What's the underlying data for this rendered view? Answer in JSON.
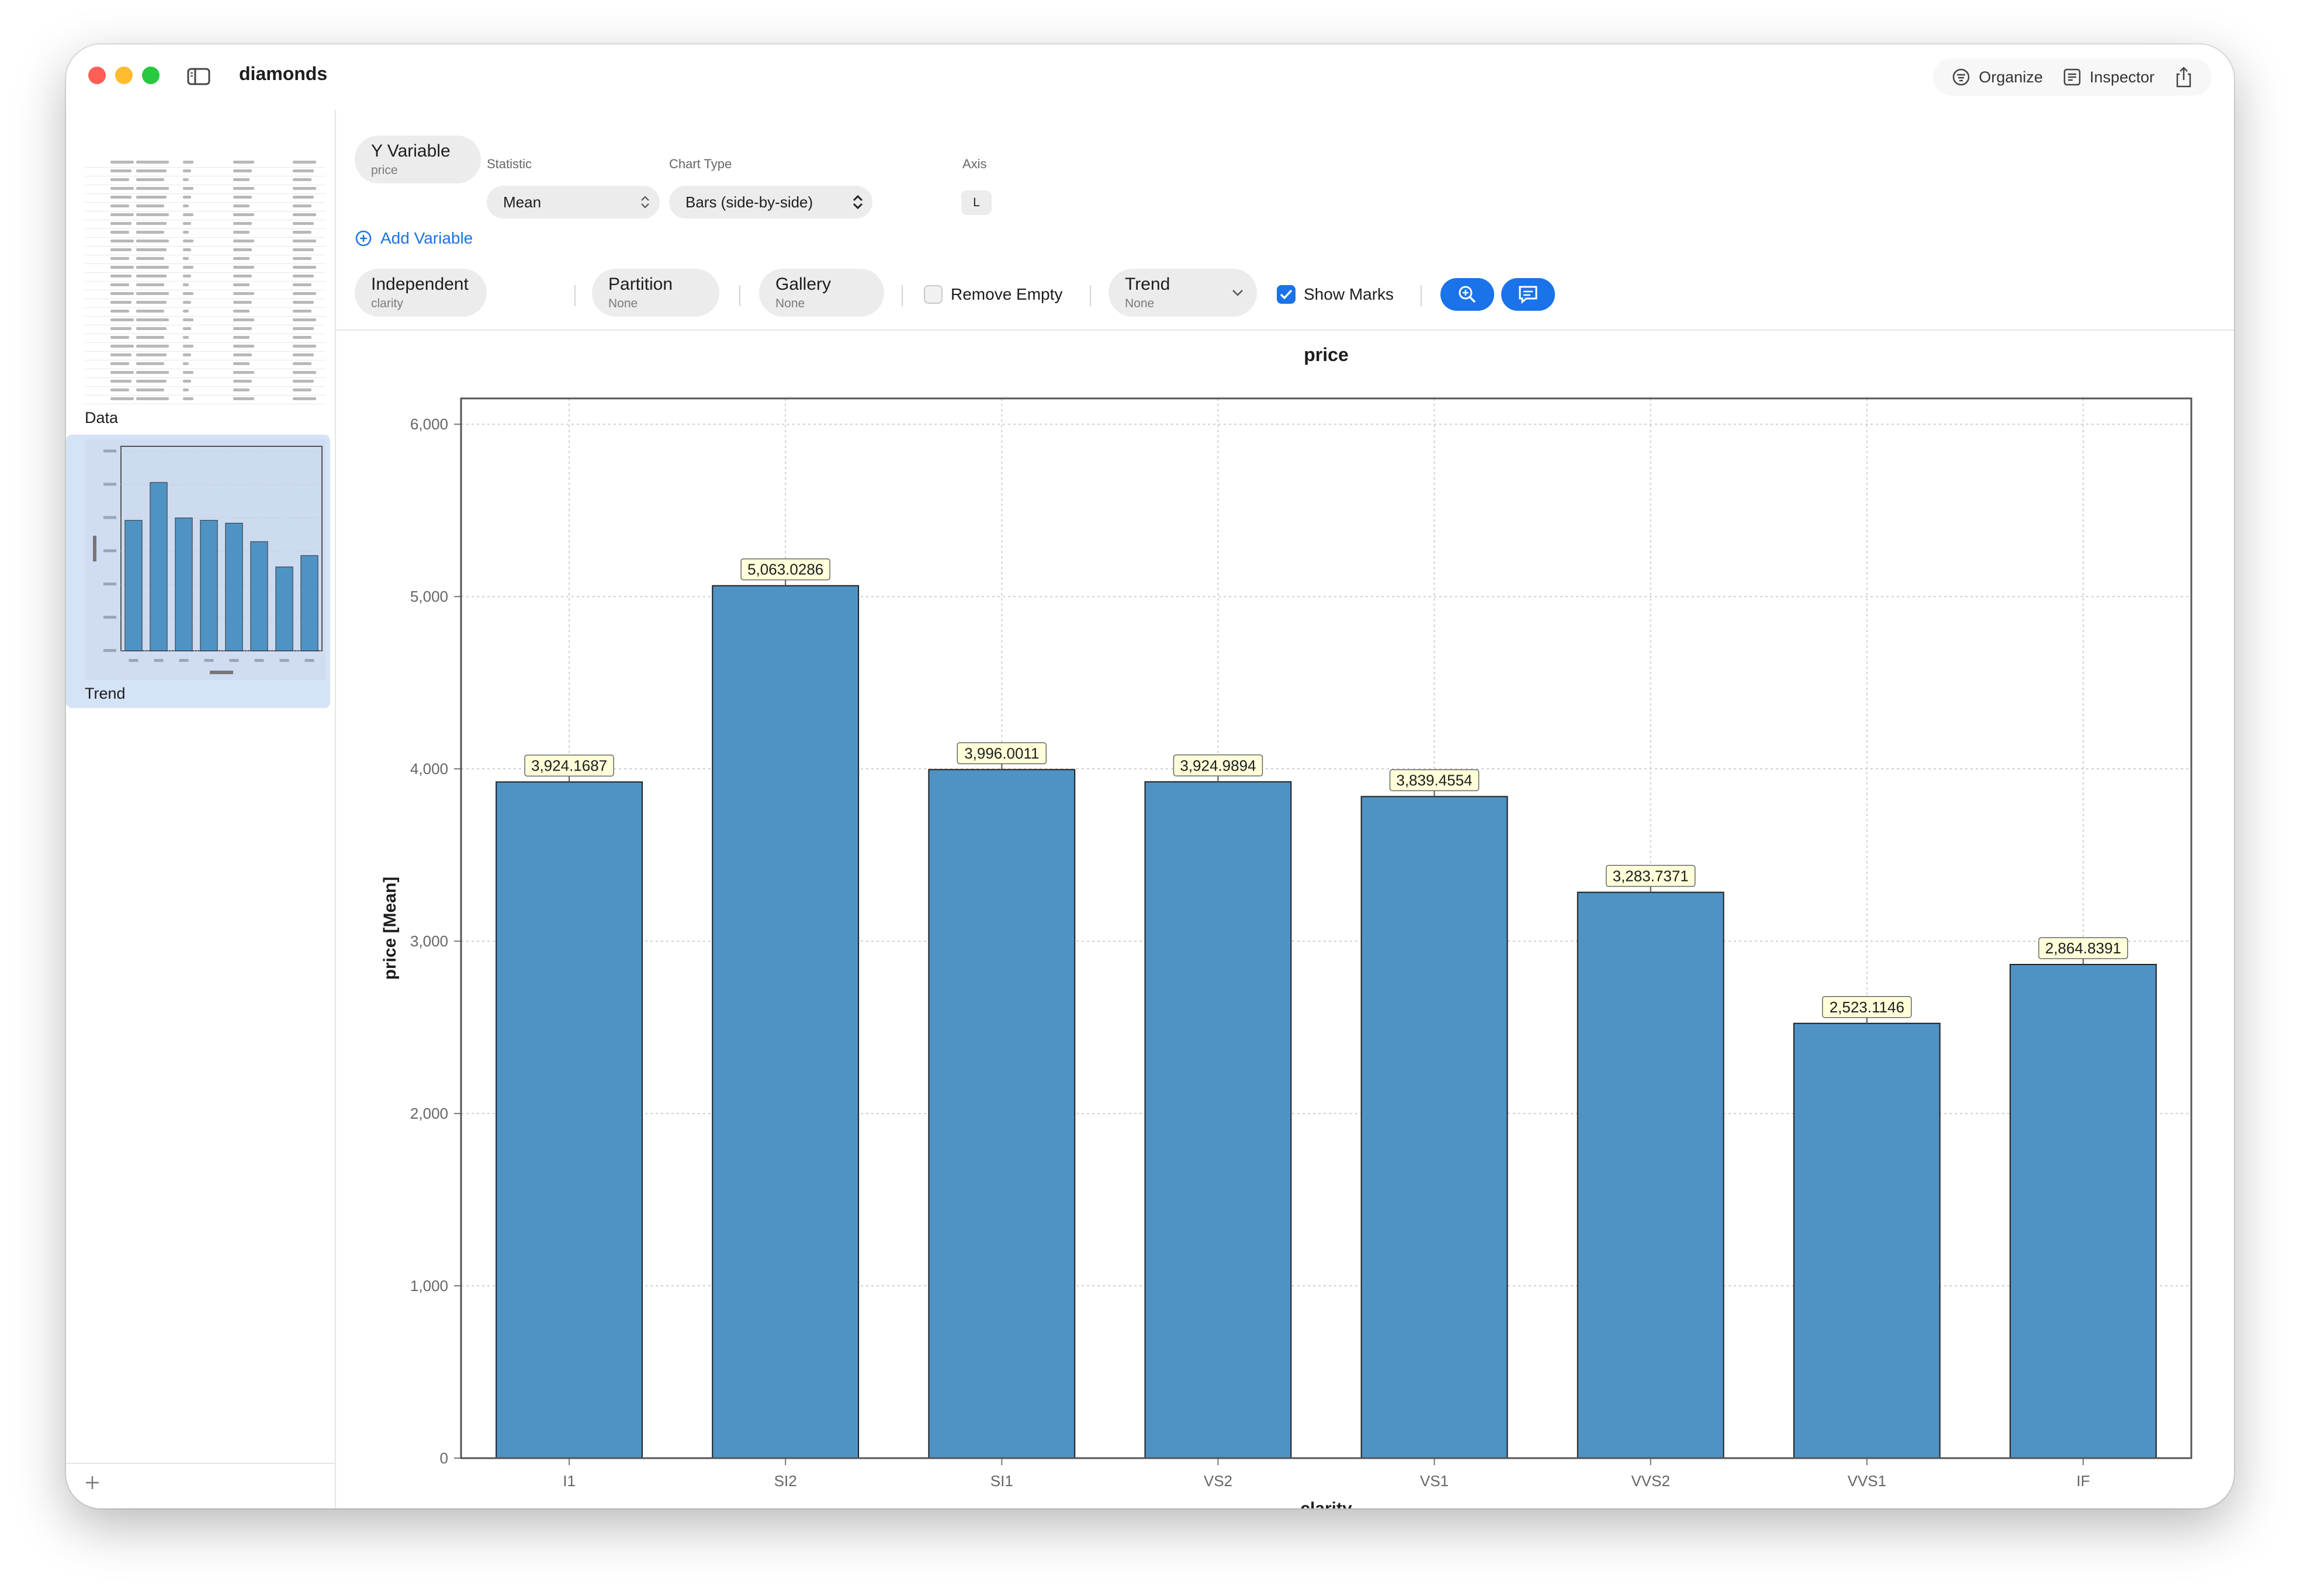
{
  "window": {
    "title": "diamonds"
  },
  "toolbar": {
    "organize_label": "Organize",
    "inspector_label": "Inspector"
  },
  "sidebar": {
    "items": [
      {
        "label": "Data"
      },
      {
        "label": "Trend"
      }
    ]
  },
  "controls": {
    "y_variable": {
      "title": "Y Variable",
      "value": "price"
    },
    "statistic": {
      "label": "Statistic",
      "value": "Mean"
    },
    "chart_type": {
      "label": "Chart Type",
      "value": "Bars (side-by-side)"
    },
    "axis": {
      "label": "Axis",
      "value": "L"
    },
    "add_variable_label": "Add Variable",
    "independent": {
      "title": "Independent",
      "value": "clarity"
    },
    "partition": {
      "title": "Partition",
      "value": "None"
    },
    "gallery": {
      "title": "Gallery",
      "value": "None"
    },
    "remove_empty": {
      "label": "Remove Empty",
      "checked": false
    },
    "trend": {
      "title": "Trend",
      "value": "None"
    },
    "show_marks": {
      "label": "Show Marks",
      "checked": true
    }
  },
  "colors": {
    "accent": "#1a73e8",
    "bar": "#4f93c4",
    "label_bg": "#ffffd9"
  },
  "icons": [
    "sidebar-icon",
    "organize-icon",
    "inspector-icon",
    "share-icon",
    "plus-circle-icon",
    "zoom-icon",
    "comment-icon",
    "checkmark-icon",
    "chevron-down-icon",
    "updown-icon",
    "plus-icon"
  ],
  "chart_data": {
    "type": "bar",
    "title": "price",
    "xlabel": "clarity",
    "ylabel": "price [Mean]",
    "categories": [
      "I1",
      "SI2",
      "SI1",
      "VS2",
      "VS1",
      "VVS2",
      "VVS1",
      "IF"
    ],
    "values": [
      3924.1687,
      5063.0286,
      3996.0011,
      3924.9894,
      3839.4554,
      3283.7371,
      2523.1146,
      2864.8391
    ],
    "value_labels": [
      "3,924.1687",
      "5,063.0286",
      "3,996.0011",
      "3,924.9894",
      "3,839.4554",
      "3,283.7371",
      "2,523.1146",
      "2,864.8391"
    ],
    "yticks": [
      0,
      1000,
      2000,
      3000,
      4000,
      5000,
      6000
    ],
    "ytick_labels": [
      "0",
      "1,000",
      "2,000",
      "3,000",
      "4,000",
      "5,000",
      "6,000"
    ],
    "ylim": [
      0,
      6150
    ],
    "grid": true,
    "legend": false
  }
}
